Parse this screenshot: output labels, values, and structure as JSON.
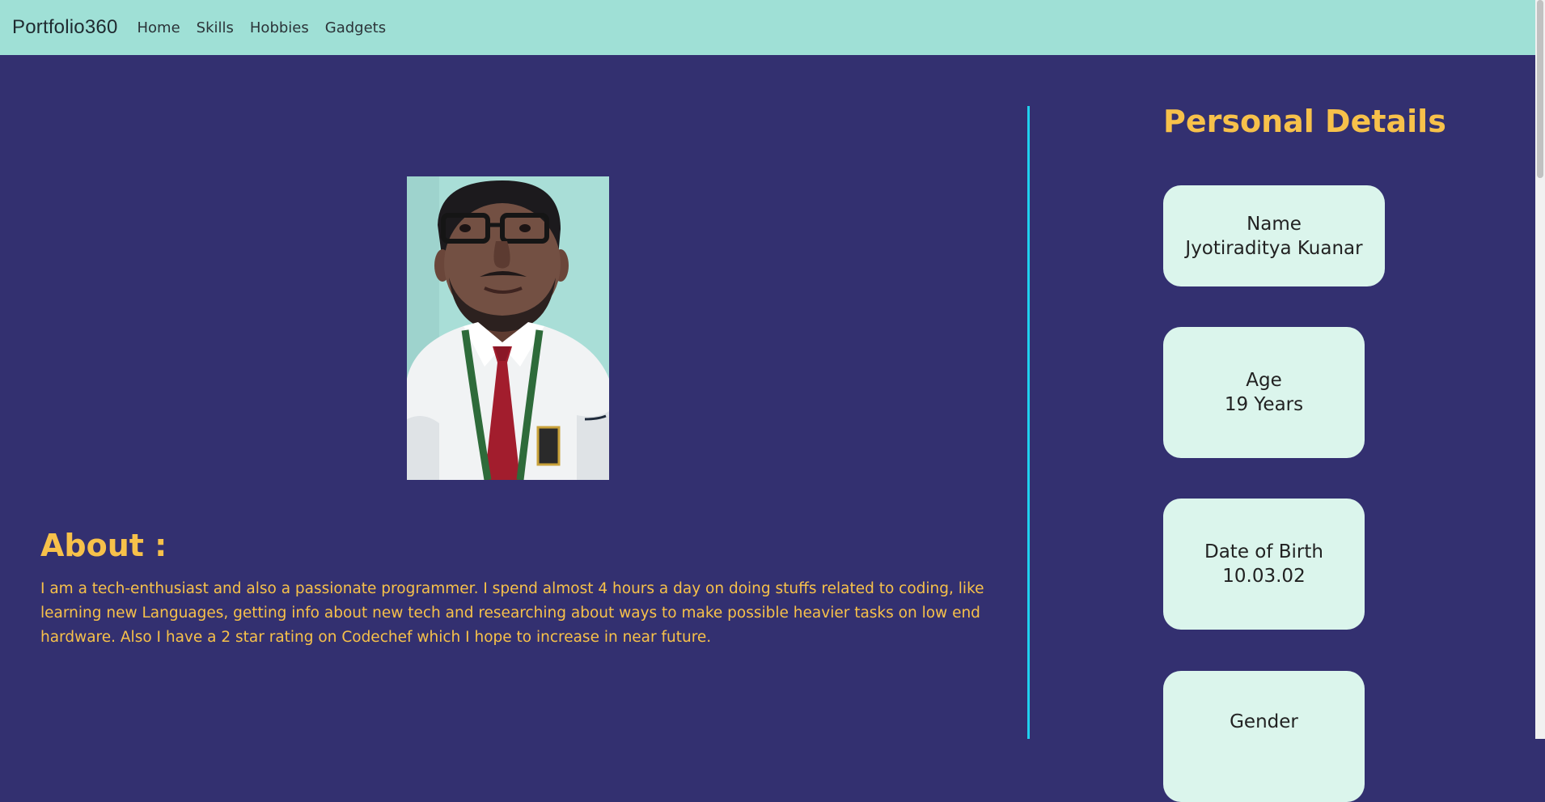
{
  "nav": {
    "brand": "Portfolio360",
    "links": [
      "Home",
      "Skills",
      "Hobbies",
      "Gadgets"
    ]
  },
  "about": {
    "heading": "About :",
    "text": "I am a tech-enthusiast and also a passionate programmer. I spend almost 4 hours a day on doing stuffs related to coding, like learning new Languages, getting info about new tech and researching about ways to make possible heavier tasks on low end hardware. Also I have a 2 star rating on Codechef which I hope to increase in near future."
  },
  "details": {
    "heading": "Personal Details",
    "cards": [
      {
        "label": "Name",
        "value": "Jyotiraditya Kuanar"
      },
      {
        "label": "Age",
        "value": "19 Years"
      },
      {
        "label": "Date of Birth",
        "value": "10.03.02"
      },
      {
        "label": "Gender",
        "value": ""
      }
    ]
  },
  "colors": {
    "navbar": "#9fe0d6",
    "background": "#333070",
    "accent": "#f7c14a",
    "divider": "#1fd0ee",
    "card": "#dbf5ec"
  },
  "icons": {
    "photo": "profile-photo"
  }
}
